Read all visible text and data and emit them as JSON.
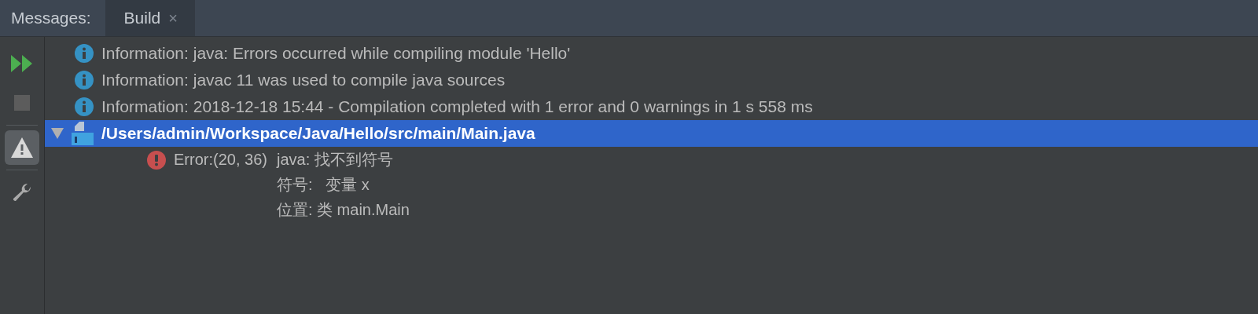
{
  "header": {
    "label": "Messages:",
    "tabs": [
      {
        "label": "Build",
        "close": "×",
        "selected": true
      }
    ]
  },
  "toolbar": [
    {
      "kind": "rerun",
      "selected": false
    },
    {
      "kind": "stop",
      "selected": false,
      "disabled": true
    },
    {
      "kind": "warnings",
      "selected": true
    },
    {
      "kind": "settings",
      "selected": false
    }
  ],
  "messages": [
    {
      "kind": "info",
      "text": "Information: java: Errors occurred while compiling module 'Hello'"
    },
    {
      "kind": "info",
      "text": "Information: javac 11 was used to compile java sources"
    },
    {
      "kind": "info",
      "text": "Information: 2018-12-18 15:44 - Compilation completed with 1 error and 0 warnings in 1 s 558 ms"
    },
    {
      "kind": "file",
      "text": "/Users/admin/Workspace/Java/Hello/src/main/Main.java",
      "expanded": true,
      "selected": true,
      "children": [
        {
          "kind": "error",
          "location": "Error:(20, 36)",
          "lines": [
            "java: 找不到符号",
            "符号:   变量 x",
            "位置: 类 main.Main"
          ]
        }
      ]
    }
  ]
}
